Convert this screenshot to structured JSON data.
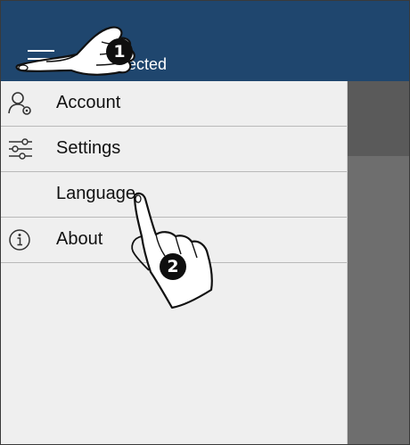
{
  "app_bar": {
    "title": "ected",
    "menu_icon": "hamburger-menu-icon",
    "background": "#1f466e"
  },
  "drawer": {
    "items": [
      {
        "label": "Account",
        "icon": "account-settings-icon"
      },
      {
        "label": "Settings",
        "icon": "sliders-icon"
      },
      {
        "label": "Language",
        "icon": ""
      },
      {
        "label": "About",
        "icon": "info-icon"
      }
    ]
  },
  "annotations": {
    "step1": "1",
    "step2": "2"
  },
  "colors": {
    "drawer_bg": "#efefef",
    "scrim": "#6e6e6e",
    "divider": "#b9b9b9"
  }
}
